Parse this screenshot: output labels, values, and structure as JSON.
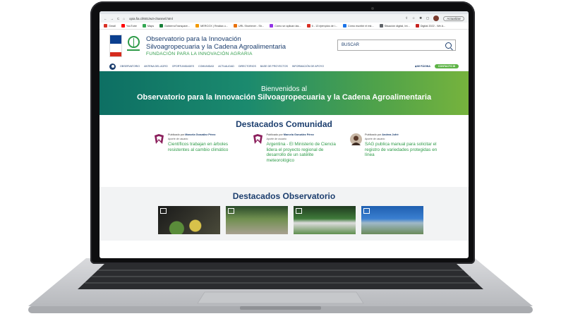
{
  "browser": {
    "url": "opia.fia.cl/601/w3-channel.html",
    "update_label": "Actualizar",
    "bookmarks": [
      "Gmail",
      "YouTube",
      "Maps",
      "GobiernoTranspare...",
      "MERCOX | Realiza u...",
      "URL Shortener - Sh...",
      "Cómo se aplican las...",
      "6 - 13 ejemplos de i...",
      "Cómo escribir el est...",
      "Situación digital, Int...",
      "Digital 2022 - We A..."
    ]
  },
  "site": {
    "title_line1": "Observatorio para la Innovación",
    "title_line2": "Silvoagropecuaria y la Cadena Agroalimentaria",
    "subtitle": "FUNDACIÓN PARA LA INNOVACIÓN AGRARIA",
    "search_placeholder": "BUSCAR"
  },
  "nav": {
    "items": [
      "OBSERVATORIO",
      "ANTENA DEL AGRO",
      "OPORTUNIDADES",
      "COMUNIDAD",
      "ACTUALIDAD",
      "DIRECTORIOS",
      "BASE DE PROYECTOS",
      "INFORMACIÓN DE APOYO"
    ],
    "mi_pagina": "MI PÁGINA",
    "contacto": "CONTACTO"
  },
  "hero": {
    "line1": "Bienvenidos al",
    "line2": "Observatorio para la Innovación Silvoagropecuaria y la Cadena Agroalimentaria"
  },
  "community": {
    "title": "Destacados Comunidad",
    "cards": [
      {
        "prefix": "Publicado por",
        "author": "Marcela González Pérez",
        "aporte": "Aporte de usuario",
        "title": "Científicos trabajan en árboles resistentes al cambio climático"
      },
      {
        "prefix": "Publicado por",
        "author": "Marcela González Pérez",
        "aporte": "Aporte de usuario",
        "title": "Argentina - El Ministerio de Ciencia lidera el proyecto regional de desarrollo de un satélite meteorológico"
      },
      {
        "prefix": "Publicado por",
        "author": "Andrea Jofré",
        "aporte": "Aporte de usuario",
        "title": "SAG publica manual para solicitar el registro de variedades protegidas en línea"
      }
    ]
  },
  "observatorio": {
    "title": "Destacados Observatorio"
  },
  "colors": {
    "brand_blue": "#1c3e6e",
    "brand_green": "#2e9b48",
    "contact_green": "#5db346"
  }
}
